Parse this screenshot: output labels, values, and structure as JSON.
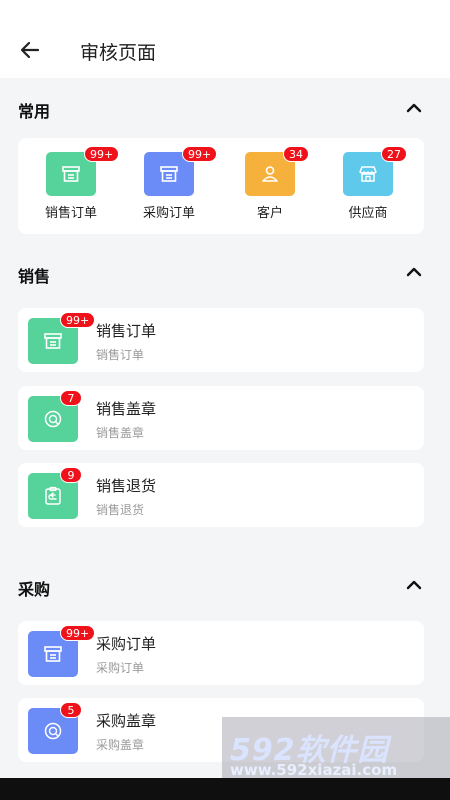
{
  "header": {
    "title": "审核页面"
  },
  "sections": {
    "common": {
      "title": "常用"
    },
    "sales": {
      "title": "销售"
    },
    "purchase": {
      "title": "采购"
    }
  },
  "quick": [
    {
      "label": "销售订单",
      "badge": "99+",
      "icon": "box-icon",
      "color": "#55d39a"
    },
    {
      "label": "采购订单",
      "badge": "99+",
      "icon": "box-icon",
      "color": "#6b8bf7"
    },
    {
      "label": "客户",
      "badge": "34",
      "icon": "person-icon",
      "color": "#f6b13c"
    },
    {
      "label": "供应商",
      "badge": "27",
      "icon": "store-icon",
      "color": "#5fc9ec"
    }
  ],
  "sales_rows": [
    {
      "title": "销售订单",
      "subtitle": "销售订单",
      "badge": "99+",
      "icon": "box-icon",
      "color": "#55d39a"
    },
    {
      "title": "销售盖章",
      "subtitle": "销售盖章",
      "badge": "7",
      "icon": "stamp-icon",
      "color": "#55d39a"
    },
    {
      "title": "销售退货",
      "subtitle": "销售退货",
      "badge": "9",
      "icon": "return-icon",
      "color": "#55d39a"
    }
  ],
  "purchase_rows": [
    {
      "title": "采购订单",
      "subtitle": "采购订单",
      "badge": "99+",
      "icon": "box-icon",
      "color": "#6b8bf7"
    },
    {
      "title": "采购盖章",
      "subtitle": "采购盖章",
      "badge": "5",
      "icon": "stamp-icon",
      "color": "#6b8bf7"
    }
  ],
  "watermark": {
    "brand": "592软件园",
    "url": "www.592xiazai.com"
  },
  "colors": {
    "badge": "#f0121b",
    "background": "#f4f5f7"
  }
}
